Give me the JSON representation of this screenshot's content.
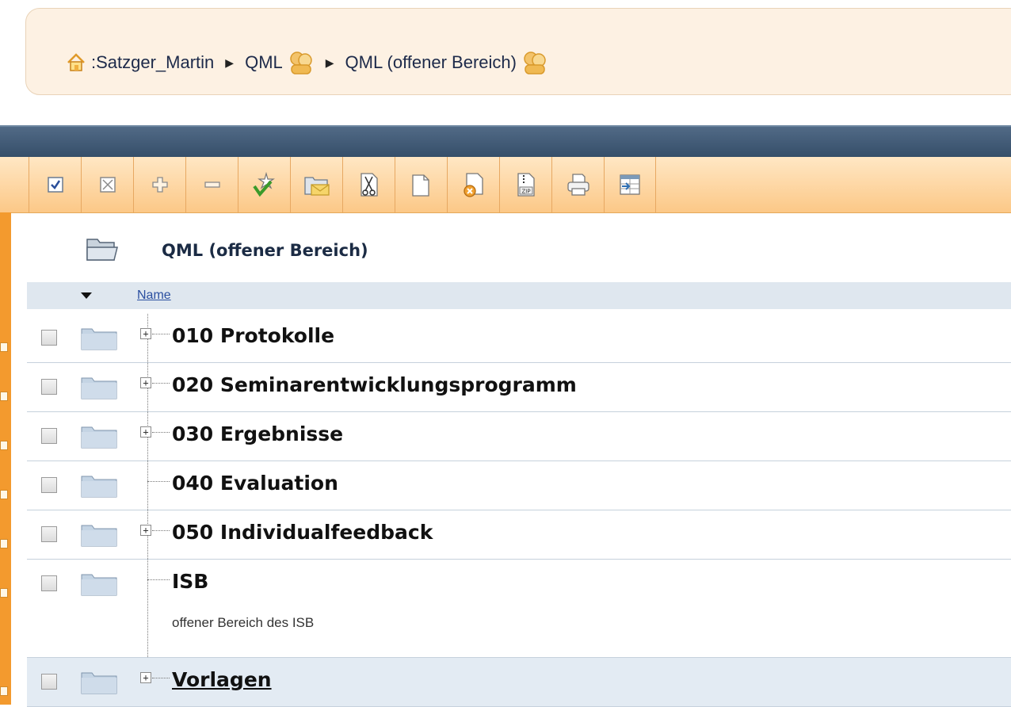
{
  "breadcrumb": {
    "home_icon": "home-icon",
    "items": [
      {
        "label": ":Satzger_Martin",
        "icon": null
      },
      {
        "label": "QML",
        "icon": "group-icon"
      },
      {
        "label": "QML (offener Bereich)",
        "icon": "group-icon"
      }
    ],
    "separator_icon": "triangle-right-icon"
  },
  "toolbar": {
    "buttons": [
      {
        "name": "select-all-button",
        "icon": "checkbox-checked-icon"
      },
      {
        "name": "deselect-all-button",
        "icon": "checkbox-x-icon"
      },
      {
        "name": "expand-all-button",
        "icon": "plus-icon"
      },
      {
        "name": "collapse-all-button",
        "icon": "minus-icon"
      },
      {
        "name": "new-button",
        "icon": "star-check-icon"
      },
      {
        "name": "send-email-button",
        "icon": "mail-folder-icon"
      },
      {
        "name": "cut-button",
        "icon": "scissors-document-icon"
      },
      {
        "name": "copy-button",
        "icon": "copy-document-icon"
      },
      {
        "name": "delete-button",
        "icon": "delete-document-icon"
      },
      {
        "name": "zip-button",
        "icon": "zip-icon"
      },
      {
        "name": "print-button",
        "icon": "print-icon"
      },
      {
        "name": "export-button",
        "icon": "export-table-icon"
      }
    ]
  },
  "folder": {
    "title": "QML (offener Bereich)",
    "icon": "folder-open-icon"
  },
  "table": {
    "column_name": "Name",
    "rows": [
      {
        "label": "010 Protokolle",
        "expandable": true,
        "desc": ""
      },
      {
        "label": "020 Seminarentwicklungsprogramm",
        "expandable": true,
        "desc": ""
      },
      {
        "label": "030 Ergebnisse",
        "expandable": true,
        "desc": ""
      },
      {
        "label": "040 Evaluation",
        "expandable": false,
        "desc": ""
      },
      {
        "label": "050 Individualfeedback",
        "expandable": true,
        "desc": ""
      },
      {
        "label": "ISB",
        "expandable": false,
        "desc": "offener Bereich des ISB"
      },
      {
        "label": "Vorlagen",
        "expandable": true,
        "desc": ""
      }
    ]
  },
  "colors": {
    "accent_orange": "#f39a2e",
    "header_blue": "#3d5671",
    "breadcrumb_bg": "#fdf1e3",
    "row_highlight": "#e3ebf3"
  }
}
